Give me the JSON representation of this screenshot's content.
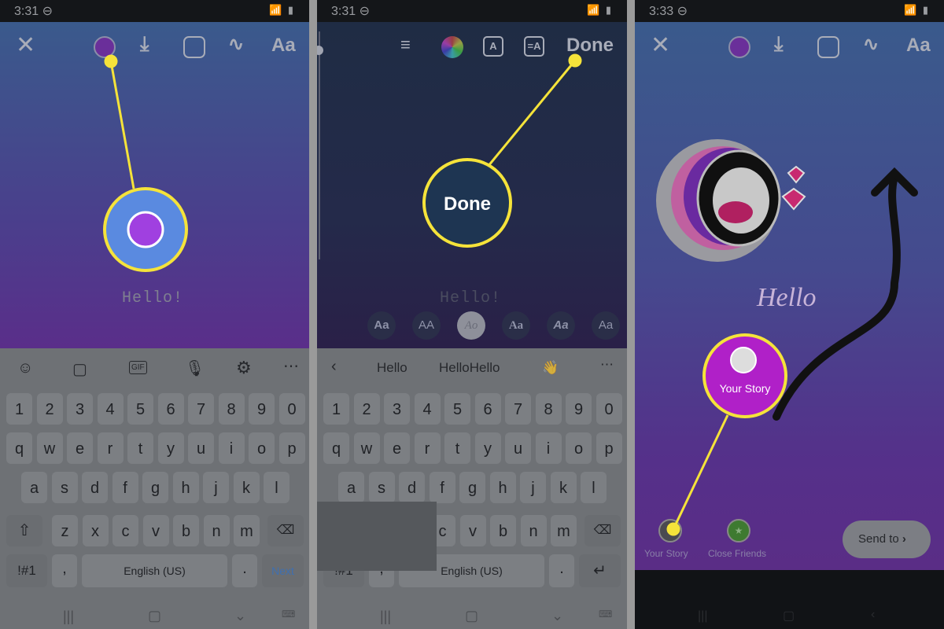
{
  "colors": {
    "callout": "#f5e33a",
    "accent_next": "#3f6fb0"
  },
  "panel1": {
    "time": "3:31",
    "toolbar": {
      "close": "close-icon",
      "color": "color-picker-icon",
      "download": "download-icon",
      "sticker": "sticker-icon",
      "draw": "draw-icon",
      "text": "Aa"
    },
    "text": "Hello!",
    "kb_toolbar": [
      "emoji-icon",
      "sticker-icon",
      "GIF",
      "mic-icon",
      "gear-icon",
      "more-icon"
    ],
    "rows": [
      [
        "1",
        "2",
        "3",
        "4",
        "5",
        "6",
        "7",
        "8",
        "9",
        "0"
      ],
      [
        "q",
        "w",
        "e",
        "r",
        "t",
        "y",
        "u",
        "i",
        "o",
        "p"
      ],
      [
        "a",
        "s",
        "d",
        "f",
        "g",
        "h",
        "j",
        "k",
        "l"
      ],
      [
        "z",
        "x",
        "c",
        "v",
        "b",
        "n",
        "m"
      ]
    ],
    "sups": [
      [],
      [
        "+",
        "×",
        "÷",
        "=",
        "/",
        "_",
        "<",
        ">",
        "[",
        "]"
      ],
      [
        "!",
        "@",
        "#",
        "$",
        "%",
        "&",
        "*",
        "(",
        ")"
      ],
      [
        "-",
        "'",
        "\"",
        ":",
        ";",
        ",",
        "?"
      ]
    ],
    "sym": "!#1",
    "comma": ",",
    "space": "English (US)",
    "period": ".",
    "action": "Next"
  },
  "panel2": {
    "time": "3:31",
    "toolbar": {
      "align": "align-icon",
      "color": "color-wheel-icon",
      "effect": "text-effect-icon",
      "style": "text-style-icon",
      "done": "Done"
    },
    "callout": "Done",
    "text": "Hello!",
    "fonts": [
      "Aa",
      "AA",
      "Ao",
      "Aa",
      "Aa",
      "Aa"
    ],
    "suggestions": [
      "Hello",
      "HelloHello",
      "👋"
    ],
    "space": "English (US)"
  },
  "panel3": {
    "time": "3:33",
    "callout": "Your Story",
    "sticker_text": "Hello",
    "share": [
      {
        "label": "Your Story"
      },
      {
        "label": "Close Friends"
      }
    ],
    "send": "Send to"
  }
}
